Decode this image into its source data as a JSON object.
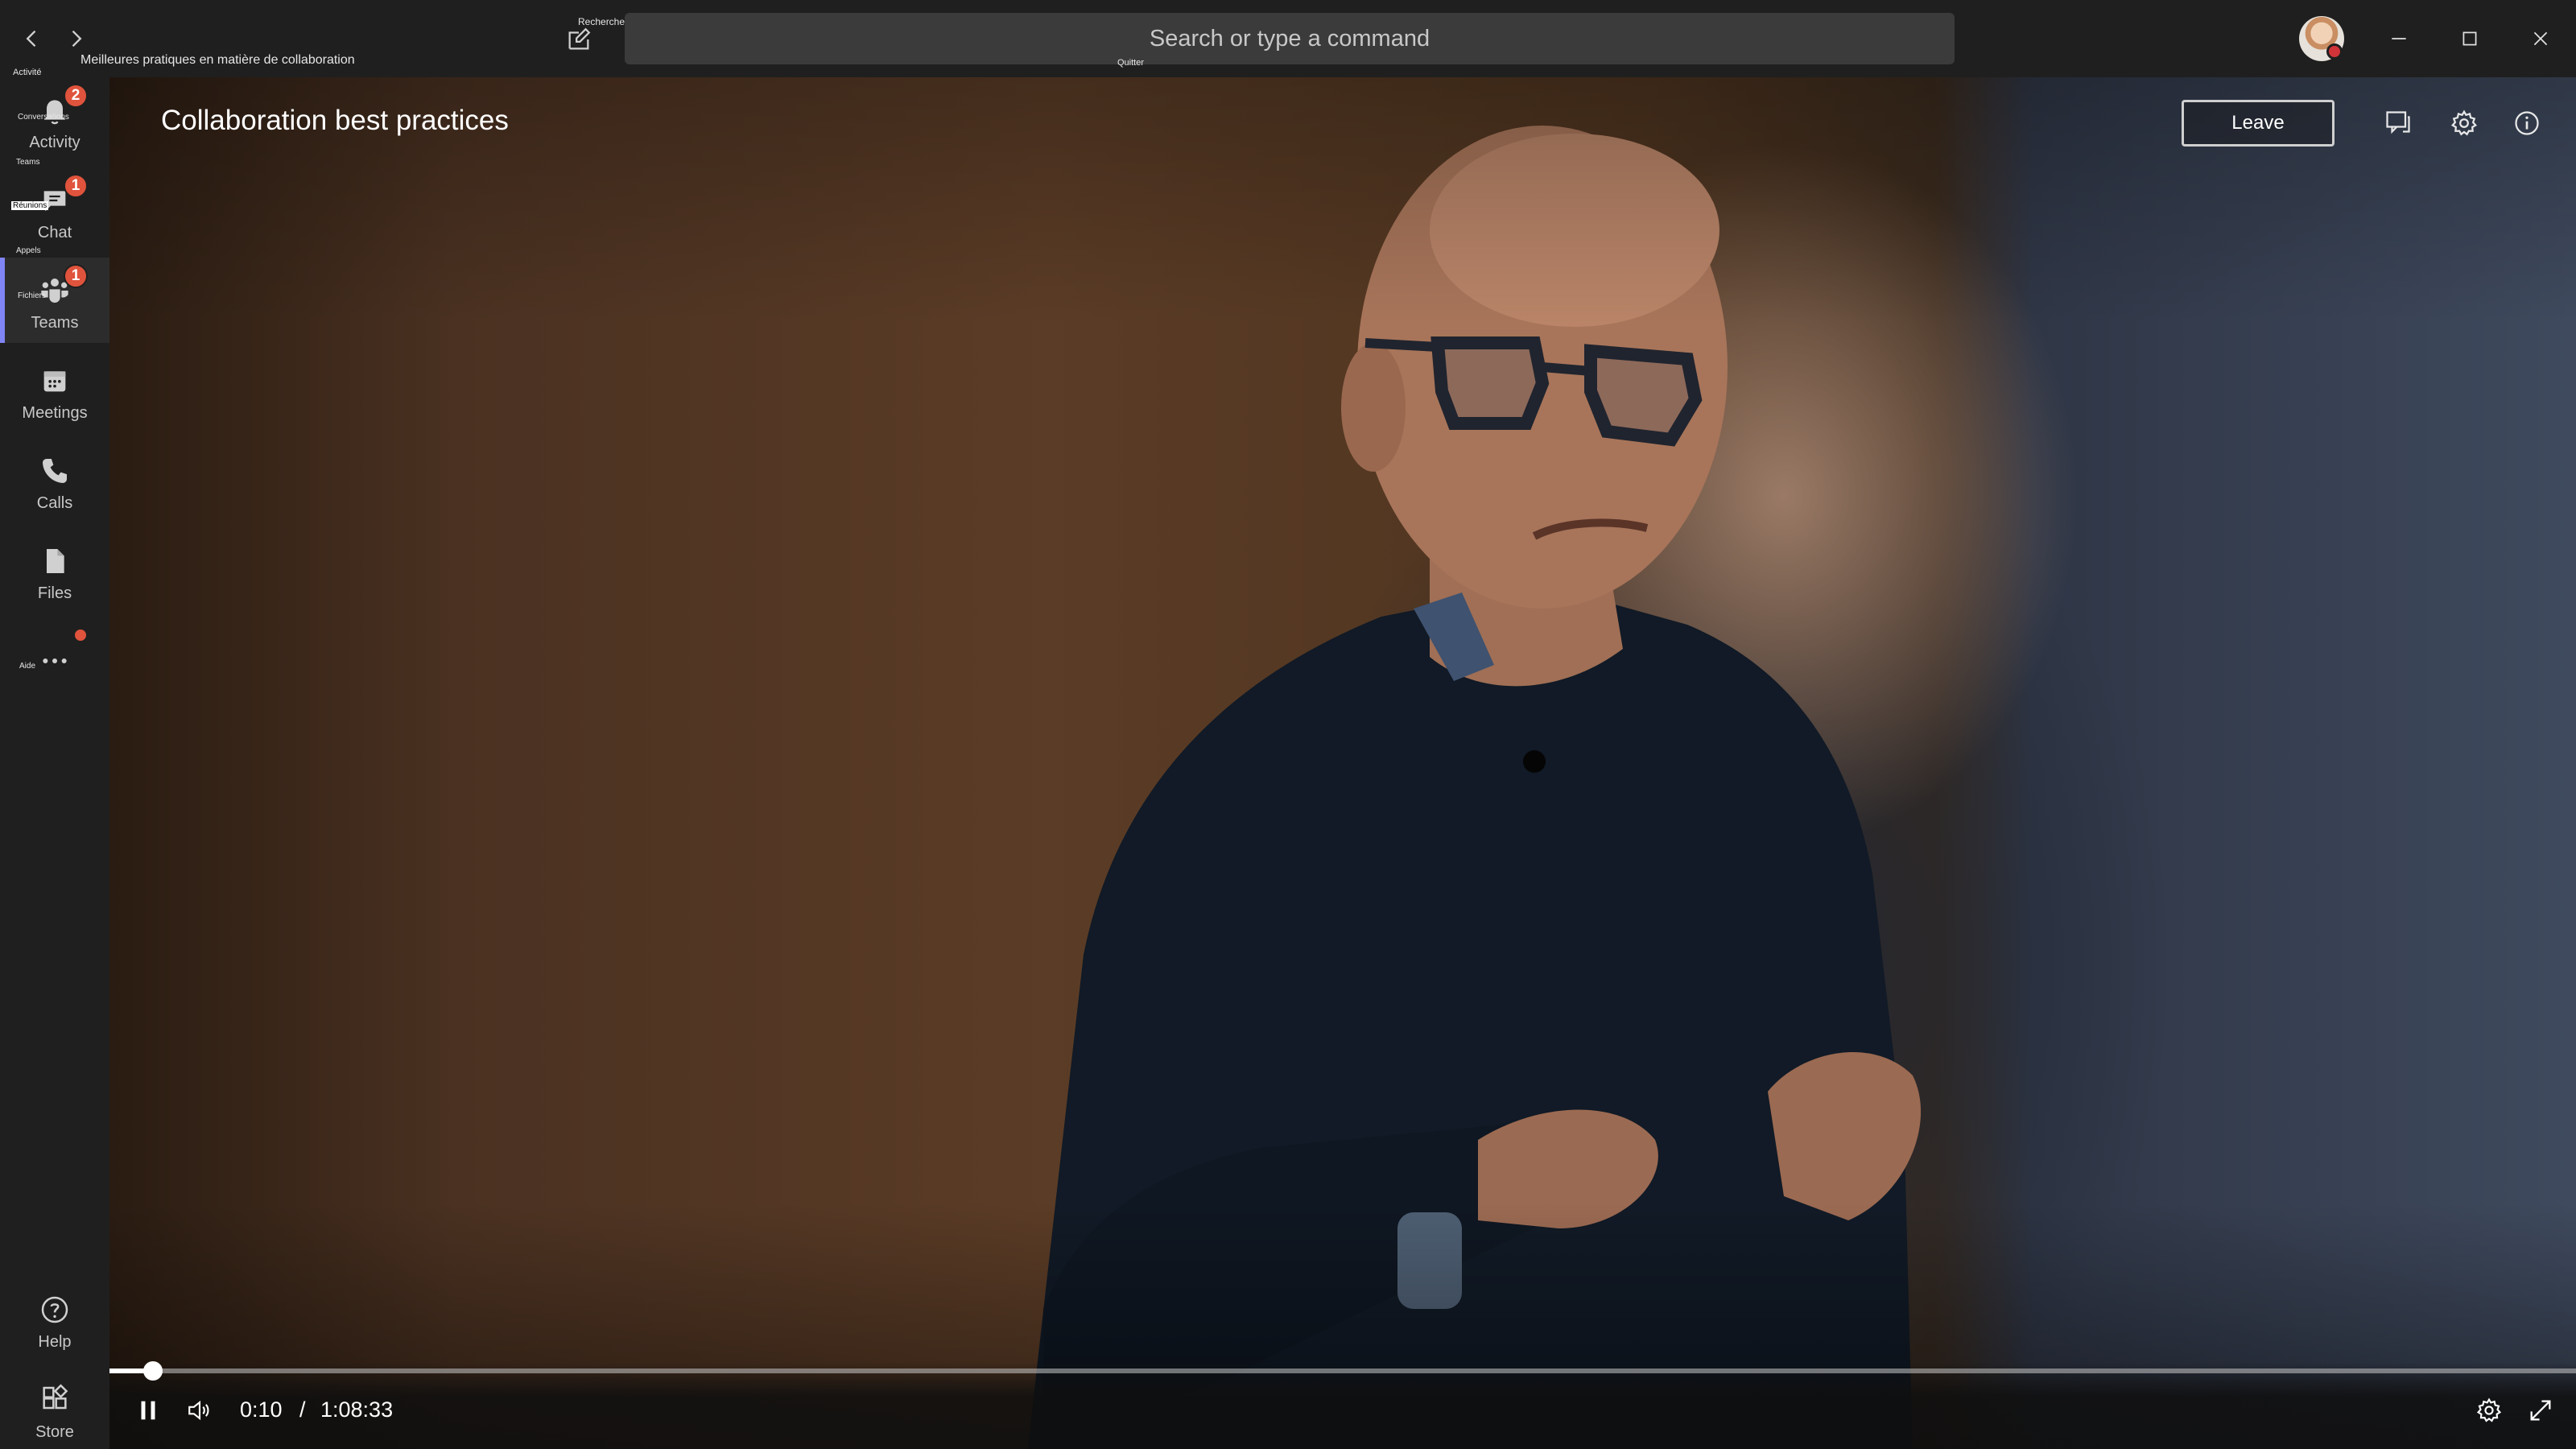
{
  "titlebar": {
    "window_label": "Meilleures pratiques en matière de collaboration",
    "compose_tooltip": "Rechercher ou taper une commande",
    "search_placeholder": "Search or type a command",
    "quit_tooltip": "Quitter",
    "small_activity": "Activité"
  },
  "sidebar": {
    "items": [
      {
        "label": "Activity",
        "icon": "bell-icon",
        "badge": "2",
        "tooltip": "Conversations"
      },
      {
        "label": "Chat",
        "icon": "chat-icon",
        "badge": "1",
        "tooltip": "Réunions",
        "tooltip2": "Teams"
      },
      {
        "label": "Teams",
        "icon": "teams-icon",
        "badge": "1",
        "tooltip": "Fichiers",
        "tooltip2": "Appels"
      },
      {
        "label": "Meetings",
        "icon": "calendar-icon"
      },
      {
        "label": "Calls",
        "icon": "phone-icon"
      },
      {
        "label": "Files",
        "icon": "file-icon"
      },
      {
        "label": "",
        "icon": "more-icon",
        "tooltip": "Aide"
      }
    ],
    "help_label": "Help",
    "store_label": "Store"
  },
  "stage": {
    "title": "Collaboration best practices",
    "leave_label": "Leave"
  },
  "player": {
    "current_time": "0:10",
    "separator": "/",
    "duration": "1:08:33",
    "progress_fraction": 0.0094
  },
  "colors": {
    "accent": "#7f85f5",
    "badge": "#e0533c",
    "presence_busy": "#d13438"
  }
}
